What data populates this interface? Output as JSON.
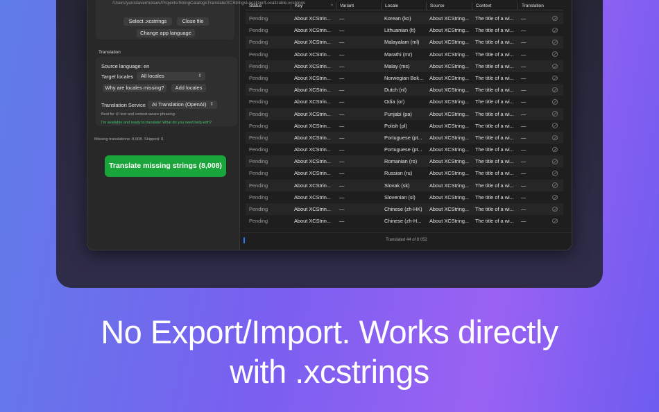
{
  "sidebar": {
    "file_path": "/Users/yaroslavermolaev/Projects/StringCatalogsTranslate/XCStringsLocalizer/Localizable.xcstrings",
    "select_button": "Select .xcstrings",
    "close_button": "Close file",
    "change_language_button": "Change app language",
    "translation_section": "Translation",
    "source_language_label": "Source language:",
    "source_language_value": "en",
    "target_locales_label": "Target locales",
    "target_locales_value": "All locales",
    "why_missing_button": "Why are locales missing?",
    "add_locales_button": "Add locales",
    "translation_service_label": "Translation Service",
    "translation_service_value": "AI Translation (OpenAI)",
    "service_hint": "Best for UI text and context-aware phrasing.",
    "ai_status": "I'm available and ready to translate! What do you need help with?",
    "missing_summary": "Missing translations: 8,008. Skipped: 0.",
    "cta_label": "Translate missing strings (8,008)"
  },
  "table": {
    "columns": [
      "Status",
      "Key",
      "Variant",
      "Locale",
      "Source",
      "Context",
      "Translation"
    ],
    "sort_indicator": "^",
    "rows": [
      {
        "status": "Pending",
        "key": "About XCStrin...",
        "variant": "—",
        "locale": "Korean (ko)",
        "source": "About XCString...",
        "context": "The title of a wi...",
        "translation": "—"
      },
      {
        "status": "Pending",
        "key": "About XCStrin...",
        "variant": "—",
        "locale": "Lithuanian (lt)",
        "source": "About XCString...",
        "context": "The title of a wi...",
        "translation": "—"
      },
      {
        "status": "Pending",
        "key": "About XCStrin...",
        "variant": "—",
        "locale": "Malayalam (ml)",
        "source": "About XCString...",
        "context": "The title of a wi...",
        "translation": "—"
      },
      {
        "status": "Pending",
        "key": "About XCStrin...",
        "variant": "—",
        "locale": "Marathi (mr)",
        "source": "About XCString...",
        "context": "The title of a wi...",
        "translation": "—"
      },
      {
        "status": "Pending",
        "key": "About XCStrin...",
        "variant": "—",
        "locale": "Malay (ms)",
        "source": "About XCString...",
        "context": "The title of a wi...",
        "translation": "—"
      },
      {
        "status": "Pending",
        "key": "About XCStrin...",
        "variant": "—",
        "locale": "Norwegian Bok...",
        "source": "About XCString...",
        "context": "The title of a wi...",
        "translation": "—"
      },
      {
        "status": "Pending",
        "key": "About XCStrin...",
        "variant": "—",
        "locale": "Dutch (nl)",
        "source": "About XCString...",
        "context": "The title of a wi...",
        "translation": "—"
      },
      {
        "status": "Pending",
        "key": "About XCStrin...",
        "variant": "—",
        "locale": "Odia (or)",
        "source": "About XCString...",
        "context": "The title of a wi...",
        "translation": "—"
      },
      {
        "status": "Pending",
        "key": "About XCStrin...",
        "variant": "—",
        "locale": "Punjabi (pa)",
        "source": "About XCString...",
        "context": "The title of a wi...",
        "translation": "—"
      },
      {
        "status": "Pending",
        "key": "About XCStrin...",
        "variant": "—",
        "locale": "Polish (pl)",
        "source": "About XCString...",
        "context": "The title of a wi...",
        "translation": "—"
      },
      {
        "status": "Pending",
        "key": "About XCStrin...",
        "variant": "—",
        "locale": "Portuguese (pt...",
        "source": "About XCString...",
        "context": "The title of a wi...",
        "translation": "—"
      },
      {
        "status": "Pending",
        "key": "About XCStrin...",
        "variant": "—",
        "locale": "Portuguese (pt...",
        "source": "About XCString...",
        "context": "The title of a wi...",
        "translation": "—"
      },
      {
        "status": "Pending",
        "key": "About XCStrin...",
        "variant": "—",
        "locale": "Romanian (ro)",
        "source": "About XCString...",
        "context": "The title of a wi...",
        "translation": "—"
      },
      {
        "status": "Pending",
        "key": "About XCStrin...",
        "variant": "—",
        "locale": "Russian (ru)",
        "source": "About XCString...",
        "context": "The title of a wi...",
        "translation": "—"
      },
      {
        "status": "Pending",
        "key": "About XCStrin...",
        "variant": "—",
        "locale": "Slovak (sk)",
        "source": "About XCString...",
        "context": "The title of a wi...",
        "translation": "—"
      },
      {
        "status": "Pending",
        "key": "About XCStrin...",
        "variant": "—",
        "locale": "Slovenian (sl)",
        "source": "About XCString...",
        "context": "The title of a wi...",
        "translation": "—"
      },
      {
        "status": "Pending",
        "key": "About XCStrin...",
        "variant": "—",
        "locale": "Chinese (zh-HK)",
        "source": "About XCString...",
        "context": "The title of a wi...",
        "translation": "—"
      },
      {
        "status": "Pending",
        "key": "About XCStrin...",
        "variant": "—",
        "locale": "Chinese (zh-H...",
        "source": "About XCString...",
        "context": "The title of a wi...",
        "translation": "—"
      }
    ],
    "row_action_icon": "cancel-circle-icon"
  },
  "footer": {
    "status_text": "Translated 44 of 8 052"
  },
  "headline": {
    "line1": "No Export/Import. Works directly",
    "line2": "with .xcstrings"
  },
  "colors": {
    "cta_green": "#1aa53a",
    "ai_status_green": "#3ec46d",
    "progress_blue": "#2d7ff9"
  }
}
